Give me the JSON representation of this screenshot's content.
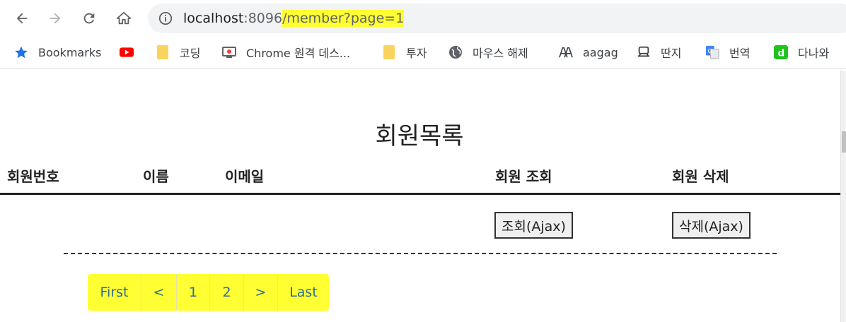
{
  "browser": {
    "url": {
      "host": "localhost",
      "port": ":8096",
      "path": "/member?page=1"
    },
    "bookmarks": [
      {
        "label": "Bookmarks",
        "icon": "star-icon"
      },
      {
        "label": "",
        "icon": "youtube-icon"
      },
      {
        "label": "코딩",
        "icon": "folder-icon"
      },
      {
        "label": "Chrome 원격 데스...",
        "icon": "remote-desktop-icon"
      },
      {
        "label": "투자",
        "icon": "folder-icon"
      },
      {
        "label": "마우스 해제",
        "icon": "globe-icon"
      },
      {
        "label": "aagag",
        "icon": "aagag-icon"
      },
      {
        "label": "딴지",
        "icon": "ddanzi-icon"
      },
      {
        "label": "번역",
        "icon": "translate-icon"
      },
      {
        "label": "다나와",
        "icon": "danawa-icon"
      }
    ],
    "colors": {
      "highlight": "#ffff33",
      "toolbar_bg": "#f1f3f4",
      "link": "#2b6e8f"
    }
  },
  "page": {
    "title": "회원목록",
    "table": {
      "headers": [
        "회원번호",
        "이름",
        "이메일",
        "회원 조회",
        "회원 삭제"
      ],
      "rows": [
        {
          "view_button": "조회(Ajax)",
          "delete_button": "삭제(Ajax)"
        }
      ]
    },
    "pagination": [
      "First",
      "<",
      "1",
      "2",
      ">",
      "Last"
    ]
  }
}
